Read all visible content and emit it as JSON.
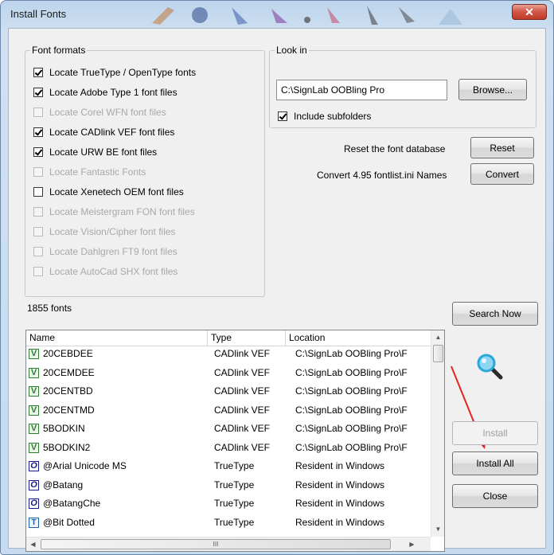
{
  "window": {
    "title": "Install Fonts",
    "close_glyph": "✕"
  },
  "font_formats": {
    "legend": "Font formats",
    "options": [
      {
        "label": "Locate TrueType / OpenType fonts",
        "checked": true,
        "enabled": true
      },
      {
        "label": "Locate Adobe Type 1 font files",
        "checked": true,
        "enabled": true
      },
      {
        "label": "Locate Corel WFN font files",
        "checked": false,
        "enabled": false
      },
      {
        "label": "Locate CADlink VEF font files",
        "checked": true,
        "enabled": true
      },
      {
        "label": "Locate URW BE font files",
        "checked": true,
        "enabled": true
      },
      {
        "label": "Locate Fantastic Fonts",
        "checked": false,
        "enabled": false
      },
      {
        "label": "Locate Xenetech OEM font files",
        "checked": false,
        "enabled": true
      },
      {
        "label": "Locate Meistergram FON font files",
        "checked": false,
        "enabled": false
      },
      {
        "label": "Locate Vision/Cipher font files",
        "checked": false,
        "enabled": false
      },
      {
        "label": "Locate Dahlgren FT9 font files",
        "checked": false,
        "enabled": false
      },
      {
        "label": "Locate AutoCad SHX font files",
        "checked": false,
        "enabled": false
      }
    ]
  },
  "look_in": {
    "legend": "Look in",
    "path_value": "C:\\SignLab OOBling Pro",
    "browse_label": "Browse...",
    "include_subfolders_label": "Include subfolders",
    "include_subfolders_checked": true
  },
  "reset": {
    "label": "Reset the font database",
    "button": "Reset"
  },
  "convert": {
    "label": "Convert 4.95 fontlist.ini Names",
    "button": "Convert"
  },
  "font_count": "1855 fonts",
  "buttons": {
    "search_now": "Search Now",
    "install": "Install",
    "install_all": "Install All",
    "close": "Close"
  },
  "list": {
    "columns": [
      "Name",
      "Type",
      "Location"
    ],
    "rows": [
      {
        "icon": "V",
        "name": "20CEBDEE",
        "type": "CADlink VEF",
        "location": "C:\\SignLab OOBling Pro\\F"
      },
      {
        "icon": "V",
        "name": "20CEMDEE",
        "type": "CADlink VEF",
        "location": "C:\\SignLab OOBling Pro\\F"
      },
      {
        "icon": "V",
        "name": "20CENTBD",
        "type": "CADlink VEF",
        "location": "C:\\SignLab OOBling Pro\\F"
      },
      {
        "icon": "V",
        "name": "20CENTMD",
        "type": "CADlink VEF",
        "location": "C:\\SignLab OOBling Pro\\F"
      },
      {
        "icon": "V",
        "name": "5BODKIN",
        "type": "CADlink VEF",
        "location": "C:\\SignLab OOBling Pro\\F"
      },
      {
        "icon": "V",
        "name": "5BODKIN2",
        "type": "CADlink VEF",
        "location": "C:\\SignLab OOBling Pro\\F"
      },
      {
        "icon": "O",
        "name": "@Arial Unicode MS",
        "type": "TrueType",
        "location": "Resident in Windows"
      },
      {
        "icon": "O",
        "name": "@Batang",
        "type": "TrueType",
        "location": "Resident in Windows"
      },
      {
        "icon": "O",
        "name": "@BatangChe",
        "type": "TrueType",
        "location": "Resident in Windows"
      },
      {
        "icon": "T",
        "name": "@Bit Dotted",
        "type": "TrueType",
        "location": "Resident in Windows"
      }
    ],
    "hscroll_thumb_glyph": "III"
  },
  "colors": {
    "annotation_arrow": "#e8241c",
    "magnifier": "#2aa8d8"
  }
}
